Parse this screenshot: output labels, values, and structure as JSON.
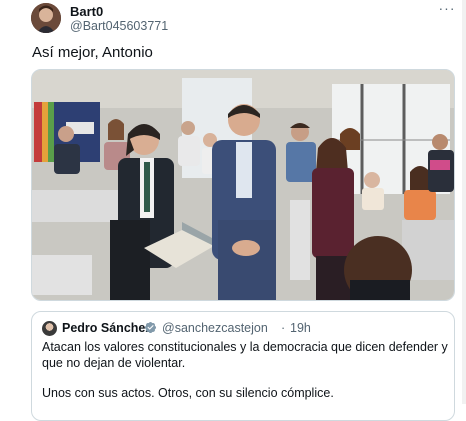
{
  "tweet": {
    "author_name": "Bart0",
    "author_handle": "@Bart045603771",
    "more_label": "···",
    "text": "Así mejor, Antonio",
    "image_alt": "photo"
  },
  "quoted_tweet": {
    "author_name": "Pedro Sánchez",
    "author_handle": "@sanchezcastejon",
    "separator": "·",
    "time": "19h",
    "paragraph_1": "Atacan los valores constitucionales y la democracia que dicen defender y que no dejan de violentar.",
    "paragraph_2": "Unos con sus actos. Otros, con su silencio cómplice.",
    "verified_color": "#829aab"
  },
  "colors": {
    "text_primary": "#0f1419",
    "text_secondary": "#536471",
    "border": "#cfd9de"
  }
}
